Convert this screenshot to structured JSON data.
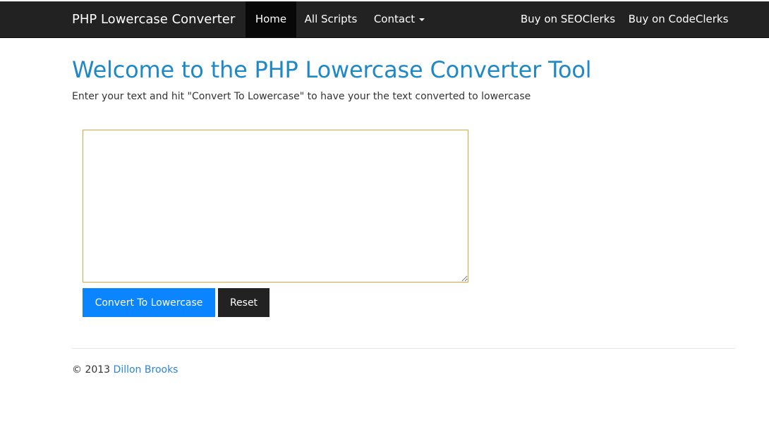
{
  "navbar": {
    "brand": "PHP Lowercase Converter",
    "items": [
      {
        "label": "Home"
      },
      {
        "label": "All Scripts"
      },
      {
        "label": "Contact"
      }
    ],
    "right_items": [
      {
        "label": "Buy on SEOClerks"
      },
      {
        "label": "Buy on CodeClerks"
      }
    ]
  },
  "main": {
    "title": "Welcome to the PHP Lowercase Converter Tool",
    "intro": "Enter your text and hit \"Convert To Lowercase\" to have your the text converted to lowercase",
    "textarea_value": "",
    "convert_label": "Convert To Lowercase",
    "reset_label": "Reset"
  },
  "footer": {
    "copyright": "© 2013",
    "author": "Dillon Brooks"
  },
  "colors": {
    "navbar_bg": "#222222",
    "title_blue": "#1f88c7",
    "primary_button": "#0a84ff",
    "textarea_focus_border": "#e3a33a",
    "link_blue": "#2a86d6"
  }
}
